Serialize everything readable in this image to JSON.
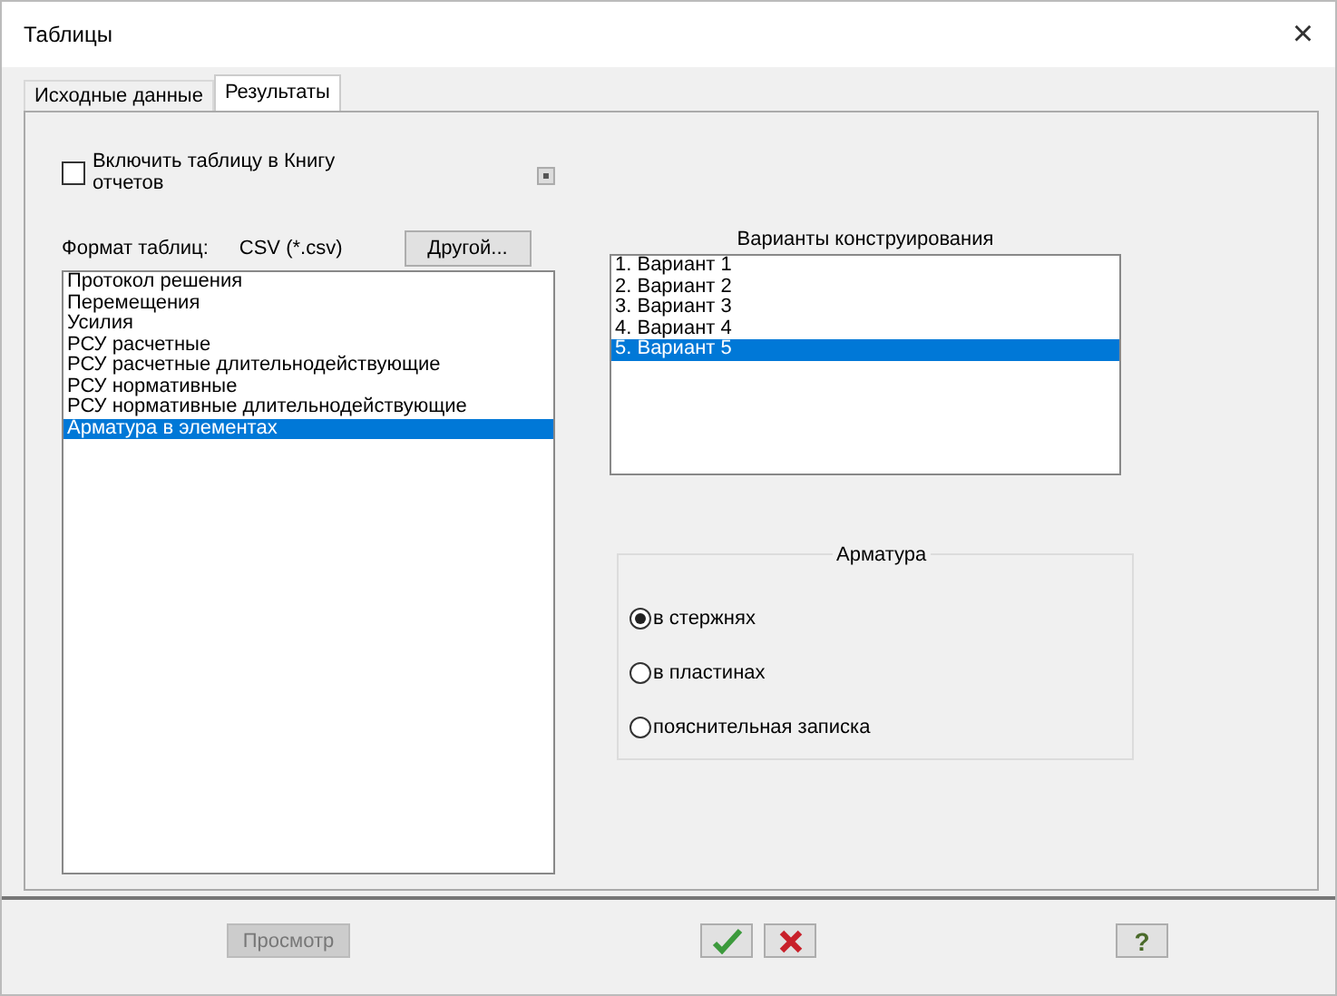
{
  "window": {
    "title": "Таблицы",
    "close": "×"
  },
  "tabs": [
    {
      "label": "Исходные данные",
      "selected": false
    },
    {
      "label": "Результаты",
      "selected": true
    }
  ],
  "include_checkbox": {
    "label": "Включить таблицу в Книгу отчетов",
    "checked": false
  },
  "format": {
    "label": "Формат таблиц:",
    "value": "CSV (*.csv)",
    "button": "Другой..."
  },
  "tables": [
    {
      "label": "Протокол решения",
      "selected": false
    },
    {
      "label": "Перемещения",
      "selected": false
    },
    {
      "label": "Усилия",
      "selected": false
    },
    {
      "label": "РСУ расчетные",
      "selected": false
    },
    {
      "label": "РСУ расчетные длительнодействующие",
      "selected": false
    },
    {
      "label": "РСУ нормативные",
      "selected": false
    },
    {
      "label": "РСУ нормативные длительнодействующие",
      "selected": false
    },
    {
      "label": "Арматура в элементах",
      "selected": true
    }
  ],
  "variants": {
    "title": "Варианты конструирования",
    "items": [
      {
        "label": "1. Вариант 1",
        "selected": false
      },
      {
        "label": "2. Вариант 2",
        "selected": false
      },
      {
        "label": "3. Вариант 3",
        "selected": false
      },
      {
        "label": "4. Вариант 4",
        "selected": false
      },
      {
        "label": "5. Вариант 5",
        "selected": true
      }
    ]
  },
  "reinforcement": {
    "title": "Арматура",
    "options": [
      {
        "label": "в стержнях",
        "selected": true
      },
      {
        "label": "в пластинах",
        "selected": false
      },
      {
        "label": "пояснительная записка",
        "selected": false
      }
    ]
  },
  "buttons": {
    "preview": {
      "label": "Просмотр",
      "disabled": true
    },
    "help": "?"
  }
}
